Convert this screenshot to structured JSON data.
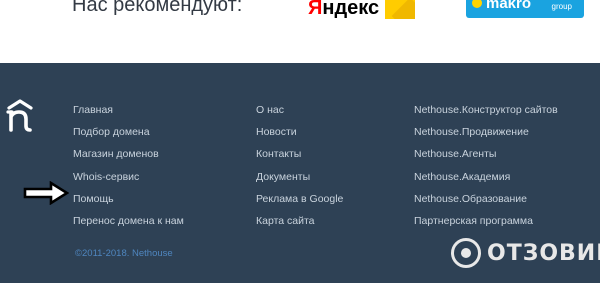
{
  "top": {
    "recommend_label": "Нас рекомендуют:",
    "yandex_first": "Я",
    "yandex_rest": "ндекс",
    "partner_name": "makro",
    "partner_group": "group"
  },
  "footer": {
    "columns": [
      [
        "Главная",
        "Подбор домена",
        "Магазин доменов",
        "Whois-сервис",
        "Помощь",
        "Перенос домена к нам"
      ],
      [
        "О нас",
        "Новости",
        "Контакты",
        "Документы",
        "Реклама в Google",
        "Карта сайта"
      ],
      [
        "Nethouse.Конструктор сайтов",
        "Nethouse.Продвижение",
        "Nethouse.Агенты",
        "Nethouse.Академия",
        "Nethouse.Образование",
        "Партнерская программа"
      ]
    ],
    "copyright": "©2011-2018. Nethouse"
  },
  "watermark": {
    "text": "ОТЗОВИК"
  },
  "colors": {
    "footer_bg": "#2e4155",
    "link": "#c9d3dd",
    "copyright": "#4f86bf",
    "yandex_red": "#ff0000",
    "yandex_yellow": "#ffcc00",
    "partner_blue": "#1aa3e0"
  },
  "icons": {
    "brand": "nethouse-logo-icon",
    "pointer": "arrow-right-icon",
    "watermark": "otzovik-logo-icon"
  }
}
